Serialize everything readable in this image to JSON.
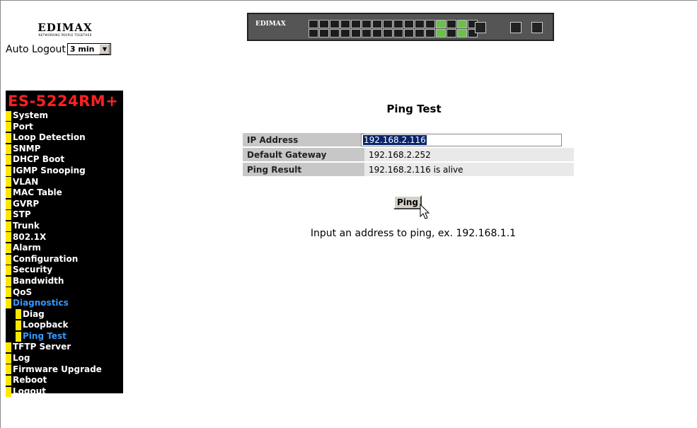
{
  "brand": {
    "name": "EDIMAX",
    "tagline": "NETWORKING PEOPLE TOGETHER"
  },
  "auto_logout": {
    "label": "Auto Logout",
    "selected": "3 min"
  },
  "device_image": {
    "brand": "EDIMAX"
  },
  "menu": {
    "title": "ES-5224RM+",
    "items": [
      {
        "label": "System",
        "active": false,
        "sub": false
      },
      {
        "label": "Port",
        "active": false,
        "sub": false
      },
      {
        "label": "Loop Detection",
        "active": false,
        "sub": false
      },
      {
        "label": "SNMP",
        "active": false,
        "sub": false
      },
      {
        "label": "DHCP Boot",
        "active": false,
        "sub": false
      },
      {
        "label": "IGMP Snooping",
        "active": false,
        "sub": false
      },
      {
        "label": "VLAN",
        "active": false,
        "sub": false
      },
      {
        "label": "MAC Table",
        "active": false,
        "sub": false
      },
      {
        "label": "GVRP",
        "active": false,
        "sub": false
      },
      {
        "label": "STP",
        "active": false,
        "sub": false
      },
      {
        "label": "Trunk",
        "active": false,
        "sub": false
      },
      {
        "label": "802.1X",
        "active": false,
        "sub": false
      },
      {
        "label": "Alarm",
        "active": false,
        "sub": false
      },
      {
        "label": "Configuration",
        "active": false,
        "sub": false
      },
      {
        "label": "Security",
        "active": false,
        "sub": false
      },
      {
        "label": "Bandwidth",
        "active": false,
        "sub": false
      },
      {
        "label": "QoS",
        "active": false,
        "sub": false
      },
      {
        "label": "Diagnostics",
        "active": true,
        "sub": false
      },
      {
        "label": "Diag",
        "active": false,
        "sub": true
      },
      {
        "label": "Loopback",
        "active": false,
        "sub": true
      },
      {
        "label": "Ping Test",
        "active": true,
        "sub": true
      },
      {
        "label": "TFTP Server",
        "active": false,
        "sub": false
      },
      {
        "label": "Log",
        "active": false,
        "sub": false
      },
      {
        "label": "Firmware Upgrade",
        "active": false,
        "sub": false
      },
      {
        "label": "Reboot",
        "active": false,
        "sub": false
      },
      {
        "label": "Logout",
        "active": false,
        "sub": false
      }
    ]
  },
  "main": {
    "title": "Ping Test",
    "ip_address_label": "IP Address",
    "ip_address_value": "192.168.2.116",
    "gateway_label": "Default Gateway",
    "gateway_value": "192.168.2.252",
    "result_label": "Ping Result",
    "result_value": "192.168.2.116 is alive",
    "ping_button": "Ping",
    "hint": "Input an address to ping, ex. 192.168.1.1"
  },
  "colors": {
    "menu_bg": "#000000",
    "menu_title": "#ff2020",
    "menu_marker": "#ffe800",
    "menu_active": "#3399ff",
    "selection": "#0a246a"
  }
}
